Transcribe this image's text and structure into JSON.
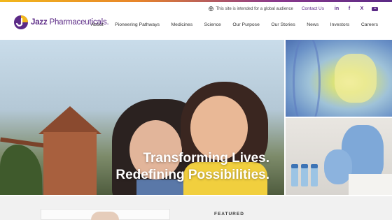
{
  "brand": {
    "name_bold": "Jazz",
    "name_rest": " Pharmaceuticals.",
    "colors": {
      "primary": "#5b2a86",
      "accent": "#f2b81c"
    }
  },
  "utility": {
    "global_note": "This site is intended for a global audience",
    "globe_icon": "globe-icon",
    "contact": "Contact Us",
    "social": [
      {
        "icon": "linkedin-icon",
        "glyph": "in"
      },
      {
        "icon": "facebook-icon",
        "glyph": "f"
      },
      {
        "icon": "x-icon",
        "glyph": "X"
      },
      {
        "icon": "youtube-icon",
        "glyph": ""
      }
    ]
  },
  "nav": {
    "items": [
      "About",
      "Pioneering Pathways",
      "Medicines",
      "Science",
      "Our Purpose",
      "Our Stories",
      "News",
      "Investors",
      "Careers"
    ]
  },
  "hero": {
    "line1": "Transforming Lives.",
    "line2": "Redefining Possibilities."
  },
  "featured": {
    "label": "FEATURED"
  }
}
